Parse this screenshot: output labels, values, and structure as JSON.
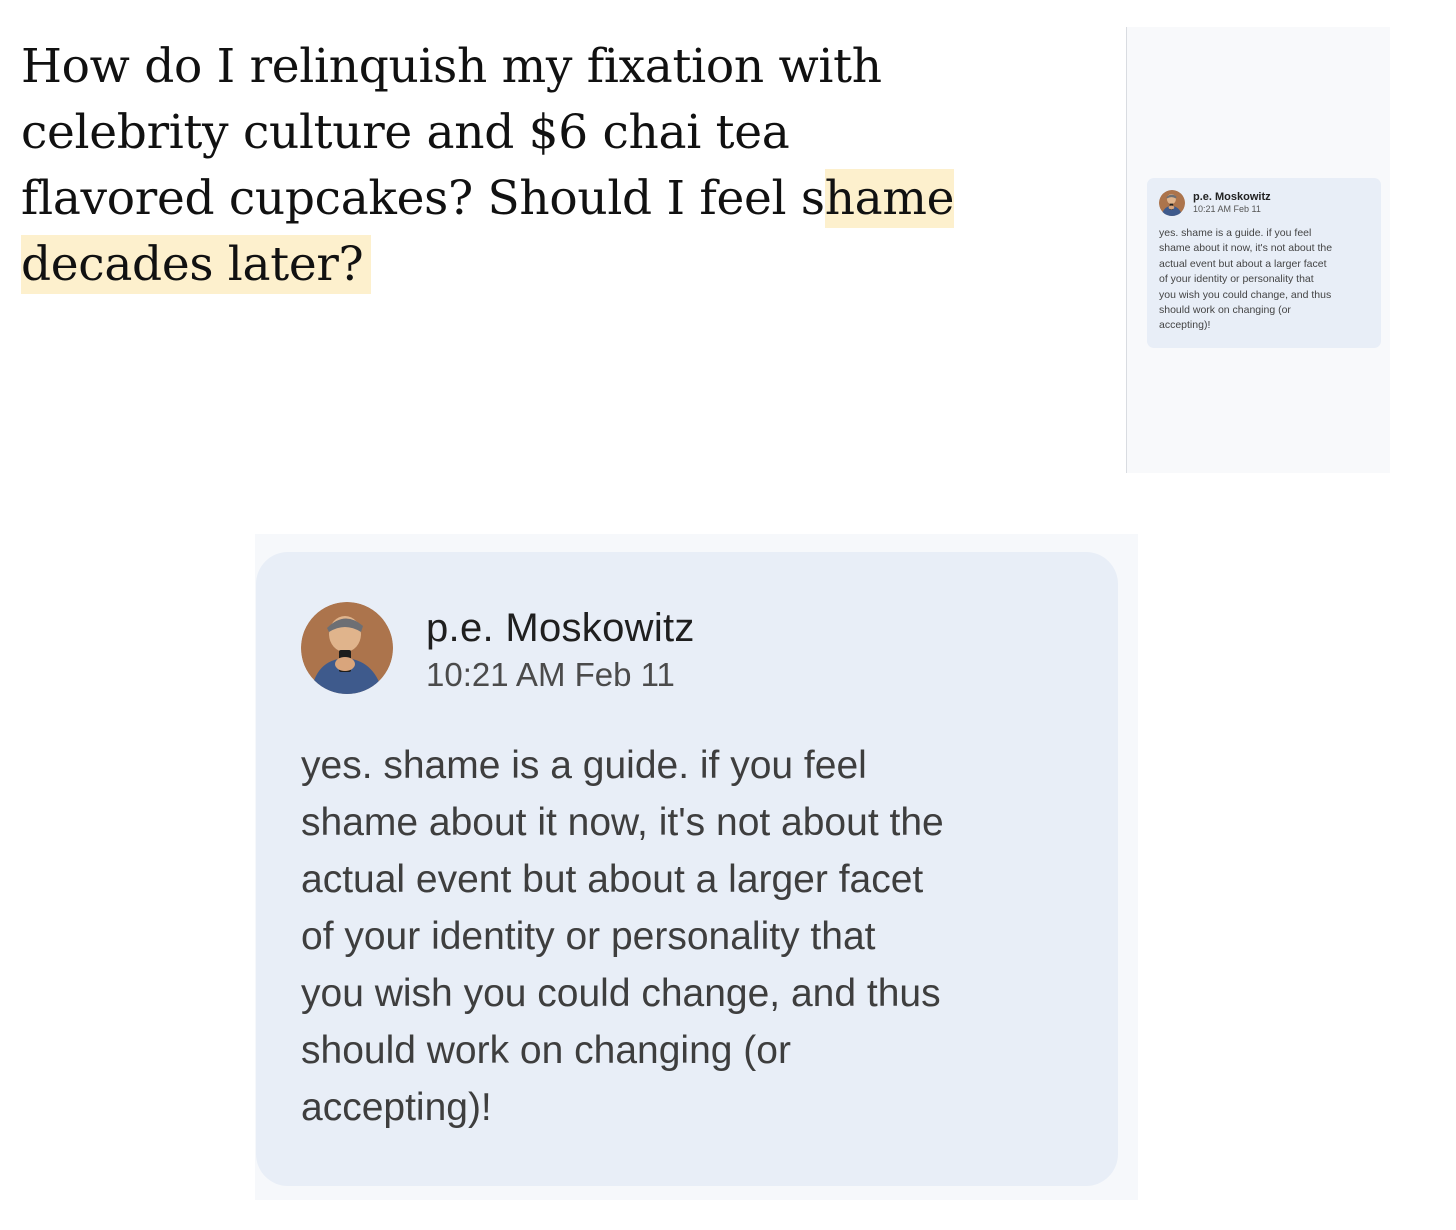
{
  "question": {
    "text_plain": "How do I relinquish my fixation with celebrity culture and $6 chai tea flavored cupcakes? Should I feel s",
    "text_highlighted": "hame decades later?"
  },
  "comment": {
    "author": "p.e. Moskowitz",
    "timestamp": "10:21 AM Feb 11",
    "body": "yes. shame is a guide. if you feel\nshame about it now, it's not about the\nactual event but about a larger facet\nof your identity or personality that\nyou wish you could change, and thus\nshould work on changing (or\naccepting)!"
  },
  "colors": {
    "highlight": "#fdf0cd",
    "card_background": "#e8eef7",
    "sidebar_background": "#f8f9fb"
  },
  "icons": {
    "avatar": "user-avatar-photo"
  }
}
